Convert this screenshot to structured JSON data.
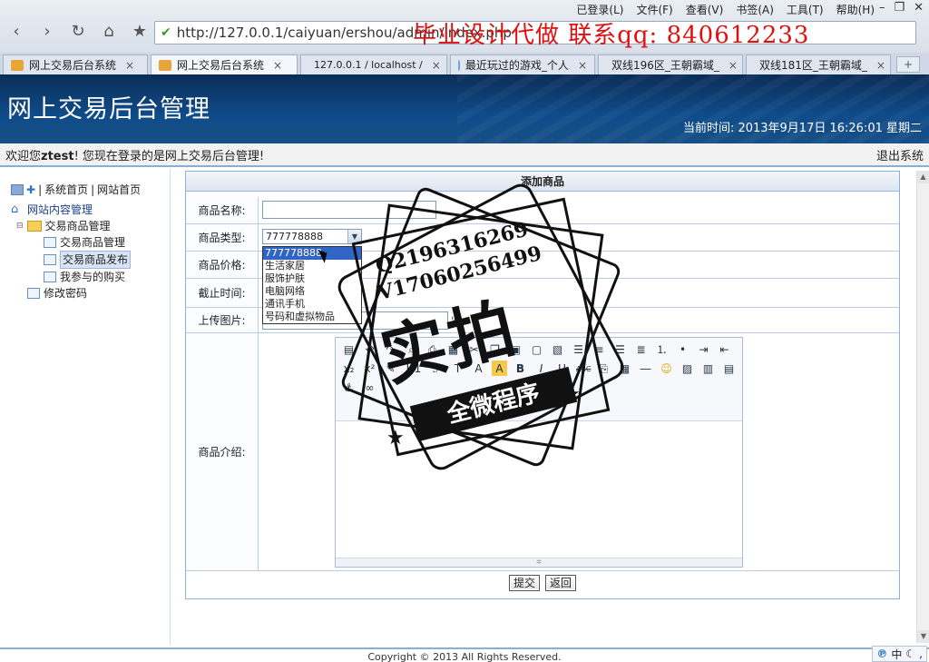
{
  "browser": {
    "menu": [
      "已登录(L)",
      "文件(F)",
      "查看(V)",
      "书签(A)",
      "工具(T)",
      "帮助(H)"
    ],
    "url": "http://127.0.0.1/caiyuan/ershou/admin/index.php",
    "overlay_ad": "毕业设计代做 联系qq: 840612233",
    "tabs": [
      {
        "label": "网上交易后台系统",
        "active": false
      },
      {
        "label": "网上交易后台系统",
        "active": true
      },
      {
        "label": "127.0.0.1 / localhost /",
        "active": false
      },
      {
        "label": "最近玩过的游戏_个人",
        "active": false
      },
      {
        "label": "双线196区_王朝霸域_",
        "active": false
      },
      {
        "label": "双线181区_王朝霸域_",
        "active": false
      }
    ]
  },
  "header": {
    "title": "网上交易后台管理",
    "time": "当前时间: 2013年9月17日 16:26:01 星期二"
  },
  "welcome": {
    "prefix": "欢迎您",
    "user": "ztest",
    "suffix": "! 您现在登录的是网上交易后台管理!",
    "logout": "退出系统"
  },
  "sidebar": {
    "top_links": [
      "系统首页",
      "网站首页"
    ],
    "root": "网站内容管理",
    "group": "交易商品管理",
    "items": [
      "交易商品管理",
      "交易商品发布",
      "我参与的购买"
    ],
    "change_password": "修改密码"
  },
  "form": {
    "title": "添加商品",
    "labels": {
      "name": "商品名称:",
      "type": "商品类型:",
      "price": "商品价格:",
      "deadline": "截止时间:",
      "image": "上传图片:",
      "intro": "商品介绍:"
    },
    "type_selected": "777778888",
    "type_options": [
      "777778888",
      "生活家居",
      "服饰护肤",
      "电脑网络",
      "通讯手机",
      "号码和虚拟物品"
    ],
    "image_browse": "览",
    "submit": "提交",
    "back": "返回"
  },
  "editor_toolbar": {
    "row3": [
      "H1",
      "A",
      "B",
      "I",
      "U",
      "ABC"
    ]
  },
  "footer": {
    "copyright": "Copyright © 2013 All Rights Reserved."
  },
  "ime": [
    "中"
  ],
  "watermark": {
    "line1": "Q2196316269",
    "line2": "V17060256499",
    "big": "实拍",
    "banner": "全微程序"
  }
}
